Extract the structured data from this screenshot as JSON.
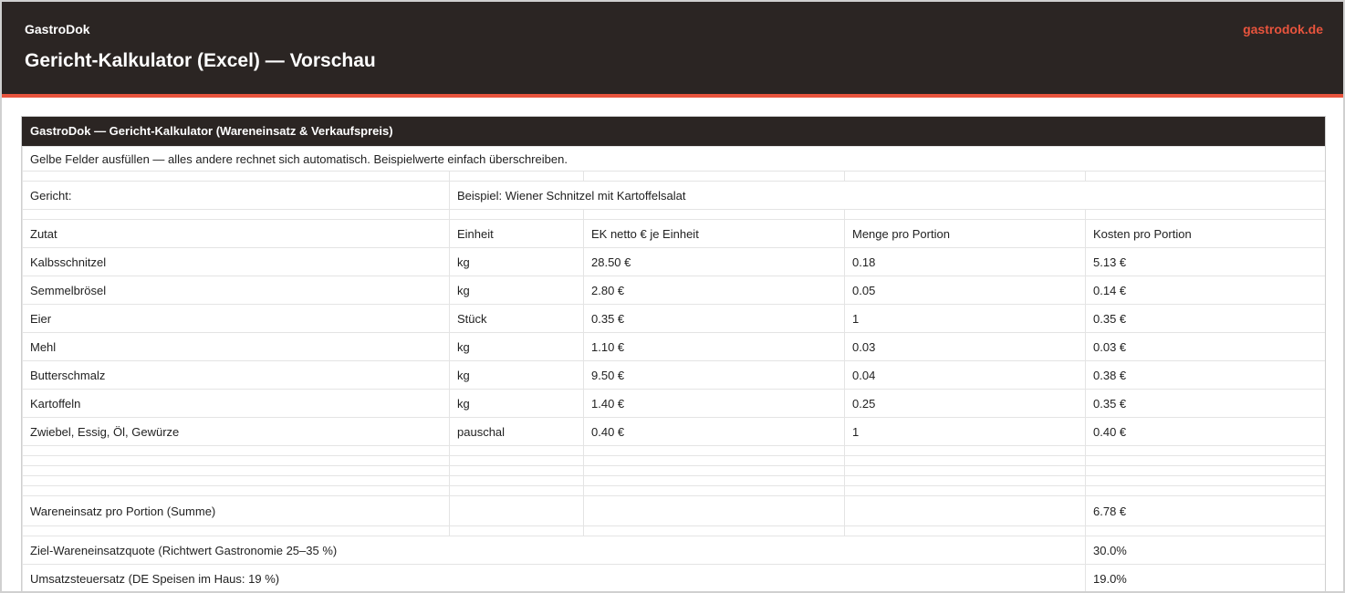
{
  "app": {
    "brand": "GastroDok",
    "title": "Gericht-Kalkulator (Excel) — Vorschau",
    "site_link": "gastrodok.de"
  },
  "sheet": {
    "header": "GastroDok — Gericht-Kalkulator (Wareneinsatz & Verkaufspreis)",
    "note": "Gelbe Felder ausfüllen — alles andere rechnet sich automatisch. Beispielwerte einfach überschreiben.",
    "dish_label": "Gericht:",
    "dish_value": "Beispiel: Wiener Schnitzel mit Kartoffelsalat",
    "columns": [
      "Zutat",
      "Einheit",
      "EK netto € je Einheit",
      "Menge pro Portion",
      "Kosten pro Portion"
    ],
    "rows": [
      [
        "Kalbsschnitzel",
        "kg",
        "28.50 €",
        "0.18",
        "5.13 €"
      ],
      [
        "Semmelbrösel",
        "kg",
        "2.80 €",
        "0.05",
        "0.14 €"
      ],
      [
        "Eier",
        "Stück",
        "0.35 €",
        "1",
        "0.35 €"
      ],
      [
        "Mehl",
        "kg",
        "1.10 €",
        "0.03",
        "0.03 €"
      ],
      [
        "Butterschmalz",
        "kg",
        "9.50 €",
        "0.04",
        "0.38 €"
      ],
      [
        "Kartoffeln",
        "kg",
        "1.40 €",
        "0.25",
        "0.35 €"
      ],
      [
        "Zwiebel, Essig, Öl, Gewürze",
        "pauschal",
        "0.40 €",
        "1",
        "0.40 €"
      ]
    ],
    "sum_label": "Wareneinsatz pro Portion (Summe)",
    "sum_value": "6.78 €",
    "quota_label": "Ziel-Wareneinsatzquote (Richtwert Gastronomie 25–35 %)",
    "quota_value": "30.0%",
    "vat_label": "Umsatzsteuersatz (DE Speisen im Haus: 19 %)",
    "vat_value": "19.0%"
  }
}
